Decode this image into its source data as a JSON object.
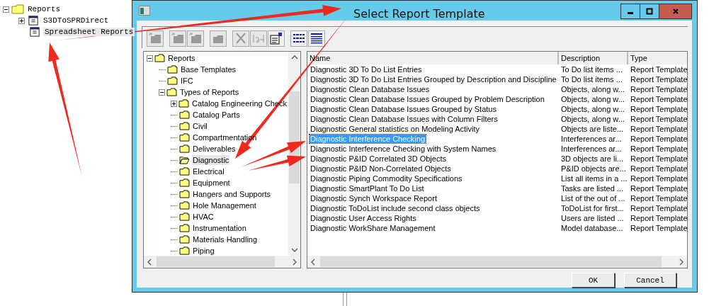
{
  "background_tree": [
    {
      "label": "Reports",
      "expanded": true,
      "selected": false,
      "children": [
        {
          "label": "S3DToSPRDirect",
          "expanded": false,
          "selected": false
        },
        {
          "label": "Spreadsheet Reports",
          "selected": true
        }
      ]
    }
  ],
  "window": {
    "title": "Select Report Template"
  },
  "toolbar": [
    {
      "kind": "new-folder",
      "disabled": true
    },
    {
      "kind": "new-folder",
      "disabled": true
    },
    {
      "kind": "new-folder",
      "disabled": true
    },
    {
      "kind": "folder",
      "disabled": true
    },
    {
      "kind": "delete",
      "disabled": true
    },
    {
      "kind": "rename",
      "disabled": true
    },
    {
      "kind": "properties",
      "disabled": false
    },
    {
      "kind": "list-view",
      "disabled": false
    },
    {
      "kind": "details-view",
      "disabled": false
    }
  ],
  "tree": [
    {
      "label": "Reports",
      "expanded": true,
      "selected": false,
      "children": [
        {
          "label": "Base Templates",
          "selected": false
        },
        {
          "label": "IFC",
          "selected": false
        },
        {
          "label": "Types of Reports",
          "expanded": true,
          "selected": false,
          "children": [
            {
              "label": "Catalog Engineering Check",
              "expanded": false,
              "selected": false
            },
            {
              "label": "Catalog Parts",
              "selected": false
            },
            {
              "label": "Civil",
              "selected": false
            },
            {
              "label": "Compartmentation",
              "selected": false
            },
            {
              "label": "Deliverables",
              "selected": false
            },
            {
              "label": "Diagnostic",
              "selected": true
            },
            {
              "label": "Electrical",
              "selected": false
            },
            {
              "label": "Equipment",
              "selected": false
            },
            {
              "label": "Hangers and Supports",
              "selected": false
            },
            {
              "label": "Hole Management",
              "selected": false
            },
            {
              "label": "HVAC",
              "selected": false
            },
            {
              "label": "Instrumentation",
              "selected": false
            },
            {
              "label": "Materials Handling",
              "selected": false
            },
            {
              "label": "Piping",
              "selected": false
            }
          ]
        }
      ]
    }
  ],
  "list": {
    "columns": [
      "Name",
      "Description",
      "Type"
    ],
    "rows": [
      {
        "name": "Diagnostic 3D To Do List Entries",
        "description": "To Do list items ...",
        "type": "Report Template",
        "selected": false
      },
      {
        "name": "Diagnostic 3D To Do List Entries Grouped by Description and Discipline",
        "description": "To Do list items ...",
        "type": "Report Template",
        "selected": false
      },
      {
        "name": "Diagnostic Clean Database Issues",
        "description": "Objects, along w...",
        "type": "Report Template",
        "selected": false
      },
      {
        "name": "Diagnostic Clean Database Issues Grouped by Problem Description",
        "description": "Objects, along w...",
        "type": "Report Template",
        "selected": false
      },
      {
        "name": "Diagnostic Clean Database Issues Grouped by Status",
        "description": "Objects, along w...",
        "type": "Report Template",
        "selected": false
      },
      {
        "name": "Diagnostic Clean Database Issues with Column Filters",
        "description": "Objects, along w...",
        "type": "Report Template",
        "selected": false
      },
      {
        "name": "Diagnostic General statistics on Modeling Activity",
        "description": "Objects are liste...",
        "type": "Report Template",
        "selected": false
      },
      {
        "name": "Diagnostic Interference Checking",
        "description": "Interferences ar...",
        "type": "Report Template",
        "selected": true
      },
      {
        "name": "Diagnostic Interference Checking with System Names",
        "description": "Interferences ar...",
        "type": "Report Template",
        "selected": false
      },
      {
        "name": "Diagnostic P&ID Correlated 3D Objects",
        "description": "3D objects are li...",
        "type": "Report Template",
        "selected": false
      },
      {
        "name": "Diagnostic P&ID Non-Correlated Objects",
        "description": "P&ID objects are...",
        "type": "Report Template",
        "selected": false
      },
      {
        "name": "Diagnostic Piping Commodity Specifications",
        "description": "List all items in a ...",
        "type": "Report Template",
        "selected": false
      },
      {
        "name": "Diagnostic SmartPlant To Do List",
        "description": "Tasks are listed ...",
        "type": "Report Template",
        "selected": false
      },
      {
        "name": "Diagnostic Synch Workspace Report",
        "description": "List of the out of ...",
        "type": "Report Template",
        "selected": false
      },
      {
        "name": "Diagnostic ToDoList include second class objects",
        "description": "ToDoList for first...",
        "type": "Report Template",
        "selected": false
      },
      {
        "name": "Diagnostic User Access Rights",
        "description": "Users are listed ...",
        "type": "Report Template",
        "selected": false
      },
      {
        "name": "Diagnostic WorkShare Management",
        "description": "Model database...",
        "type": "Report Template",
        "selected": false
      }
    ]
  },
  "buttons": [
    "OK",
    "Cancel"
  ]
}
